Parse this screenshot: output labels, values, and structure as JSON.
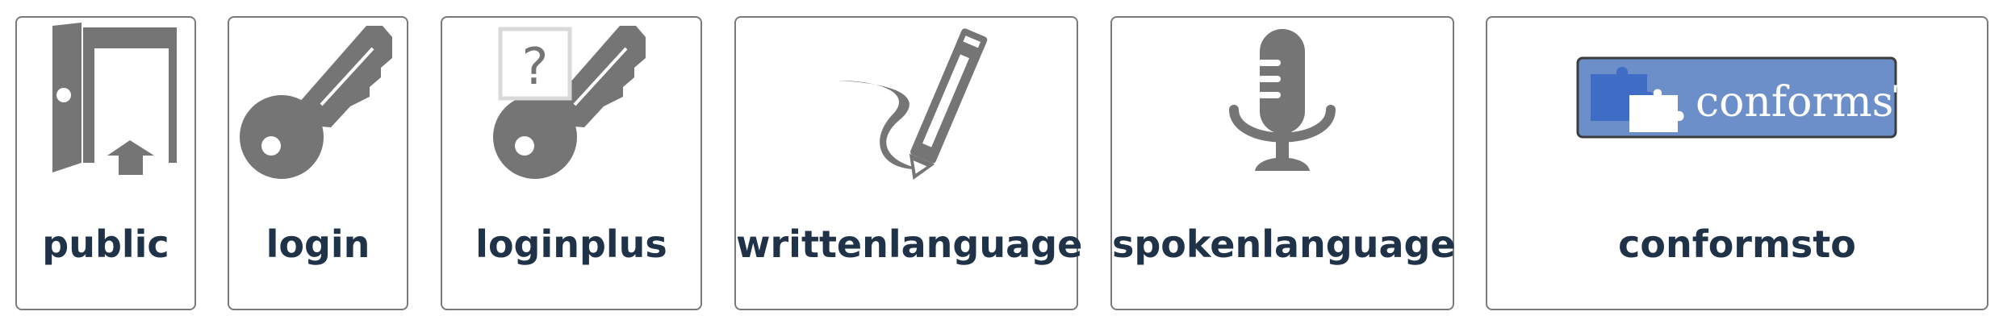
{
  "items": [
    {
      "id": "public",
      "label": "public",
      "icon": "door-exit-icon"
    },
    {
      "id": "login",
      "label": "login",
      "icon": "key-icon"
    },
    {
      "id": "loginplus",
      "label": "loginplus",
      "icon": "key-question-icon"
    },
    {
      "id": "writtenlanguage",
      "label": "writtenlanguage",
      "icon": "pencil-icon"
    },
    {
      "id": "spokenlanguage",
      "label": "spokenlanguage",
      "icon": "microphone-icon"
    },
    {
      "id": "conformsto",
      "label": "conformsto",
      "icon": "conformsto-badge-icon",
      "badge_text": "conformsTo"
    }
  ],
  "colors": {
    "icon_gray": "#757575",
    "label_text": "#1f3247",
    "card_border": "#7a7a7a",
    "badge_blue": "#6c8fc9",
    "badge_border": "#3c3c3c",
    "puzzle_blue": "#3f6cc4"
  }
}
